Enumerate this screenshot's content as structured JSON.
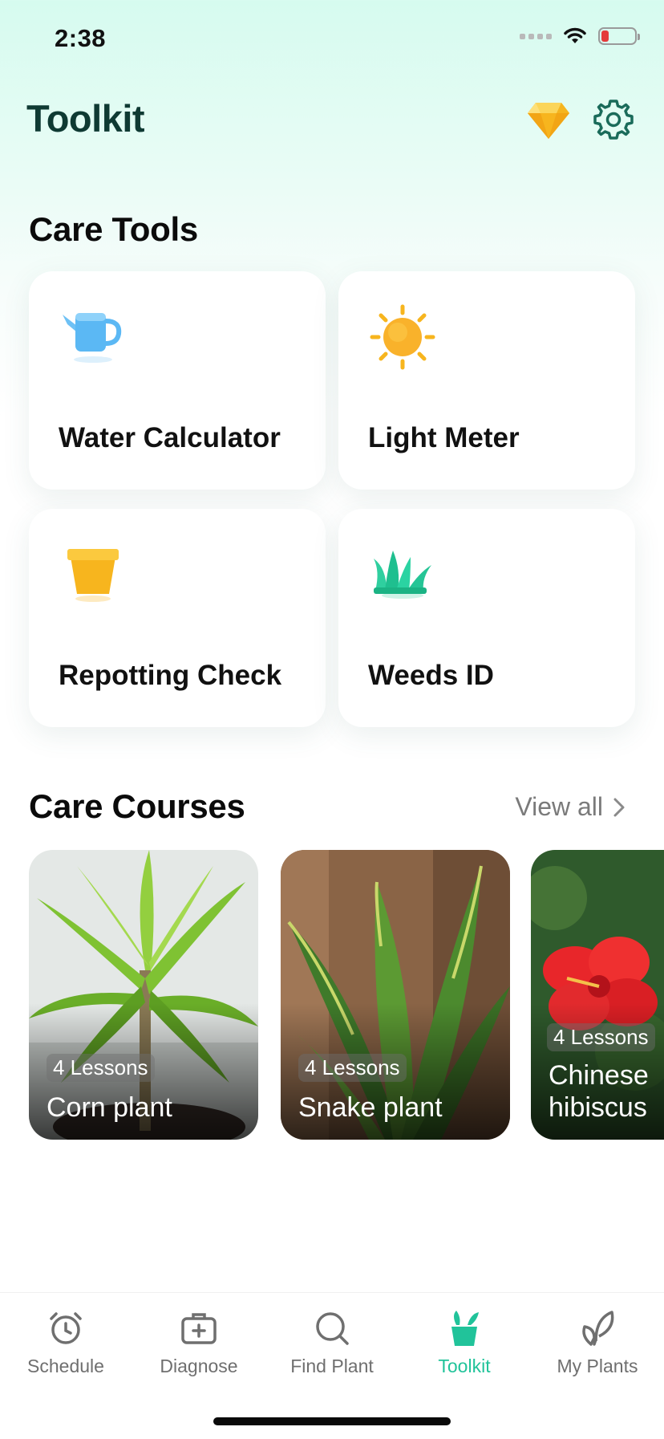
{
  "status": {
    "time": "2:38"
  },
  "header": {
    "title": "Toolkit"
  },
  "care_tools": {
    "title": "Care Tools",
    "items": [
      {
        "label": "Water Calculator",
        "icon": "watering-can-icon"
      },
      {
        "label": "Light Meter",
        "icon": "sun-icon"
      },
      {
        "label": "Repotting Check",
        "icon": "flower-pot-icon"
      },
      {
        "label": "Weeds ID",
        "icon": "grass-icon"
      }
    ]
  },
  "care_courses": {
    "title": "Care Courses",
    "view_all": "View all",
    "items": [
      {
        "lessons": "4 Lessons",
        "name": "Corn plant"
      },
      {
        "lessons": "4 Lessons",
        "name": "Snake plant"
      },
      {
        "lessons": "4 Lessons",
        "name": "Chinese hibiscus"
      }
    ]
  },
  "tabbar": {
    "items": [
      {
        "label": "Schedule",
        "icon": "alarm-clock-icon"
      },
      {
        "label": "Diagnose",
        "icon": "medical-kit-icon"
      },
      {
        "label": "Find Plant",
        "icon": "search-icon"
      },
      {
        "label": "Toolkit",
        "icon": "toolkit-icon",
        "active": true
      },
      {
        "label": "My Plants",
        "icon": "plant-leaves-icon"
      }
    ]
  },
  "colors": {
    "accent": "#21c39a",
    "title": "#0f3a33",
    "gem": "#f7b51e"
  }
}
